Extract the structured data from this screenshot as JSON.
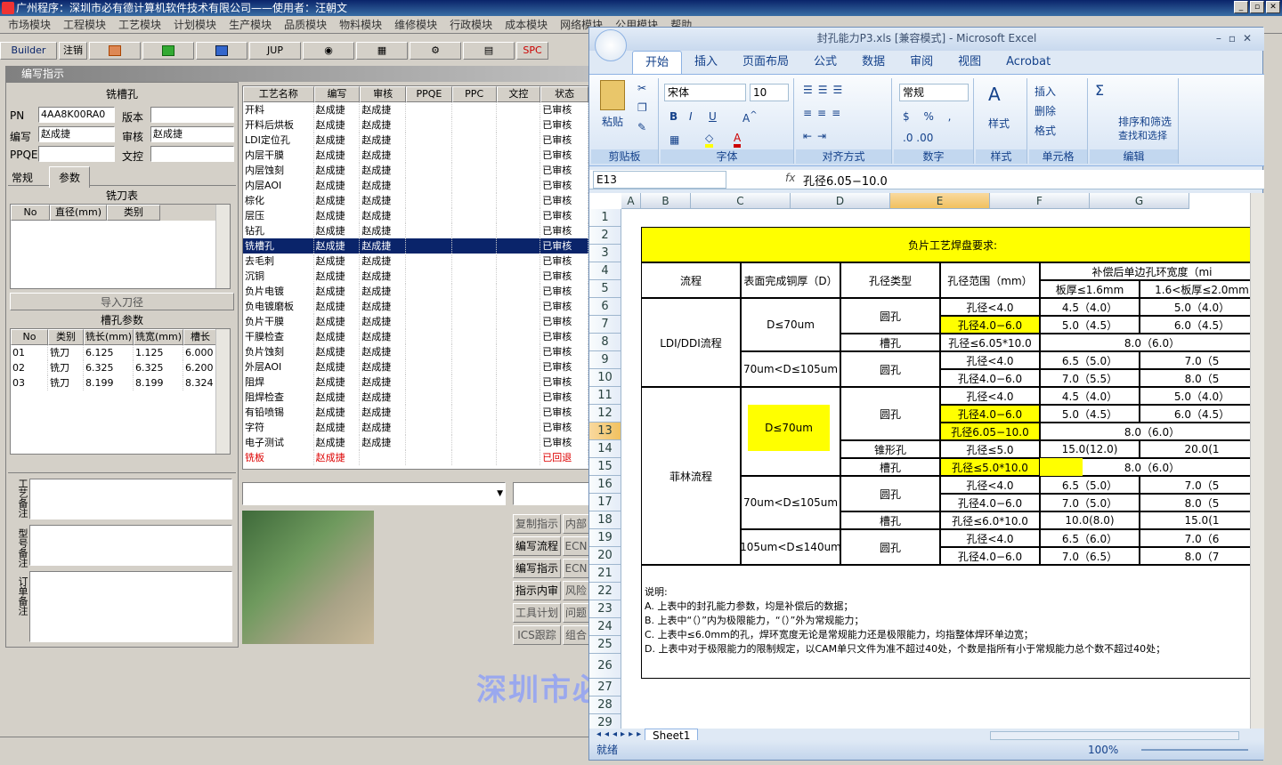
{
  "app": {
    "title": "广州程序：深圳市必有德计算机软件技术有限公司——使用者：汪朝文"
  },
  "menu": [
    "市场模块",
    "工程模块",
    "工艺模块",
    "计划模块",
    "生产模块",
    "品质模块",
    "物料模块",
    "维修模块",
    "行政模块",
    "成本模块",
    "网络模块",
    "公用模块",
    "帮助"
  ],
  "toolbar": {
    "builder": "Builder",
    "logout": "注销",
    "jup": "JUP",
    "spc": "SPC"
  },
  "panel": {
    "title": "编写指示",
    "section": "铣槽孔",
    "pn_label": "PN",
    "pn_value": "4AA8K00RA0",
    "version_label": "版本",
    "version_value": "",
    "writer_label": "编写",
    "writer_value": "赵成捷",
    "reviewer_label": "审核",
    "reviewer_value": "赵成捷",
    "ppqe_label": "PPQE",
    "ppqe_value": "",
    "doc_label": "文控",
    "doc_value": "",
    "tab_general": "常规",
    "tab_params": "参数",
    "knife_table": "铣刀表",
    "knife_cols": [
      "No",
      "直径(mm)",
      "类别"
    ],
    "import_btn": "导入刀径",
    "slot_params": "槽孔参数",
    "slot_cols": [
      "No",
      "类别",
      "铣长(mm)",
      "铣宽(mm)",
      "槽长(mm"
    ],
    "slot_rows": [
      [
        "01",
        "铣刀",
        "6.125",
        "1.125",
        "6.000"
      ],
      [
        "02",
        "铣刀",
        "6.325",
        "6.325",
        "6.200"
      ],
      [
        "03",
        "铣刀",
        "8.199",
        "8.199",
        "8.324"
      ]
    ],
    "note1": "工艺备注",
    "note2": "型号备注",
    "note3": "订单备注"
  },
  "process": {
    "cols": [
      "工艺名称",
      "编写",
      "审核",
      "PPQE",
      "PPC",
      "文控",
      "状态"
    ],
    "rows": [
      [
        "开料",
        "赵成捷",
        "赵成捷",
        "",
        "",
        "",
        "已审核"
      ],
      [
        "开料后烘板",
        "赵成捷",
        "赵成捷",
        "",
        "",
        "",
        "已审核"
      ],
      [
        "LDI定位孔",
        "赵成捷",
        "赵成捷",
        "",
        "",
        "",
        "已审核"
      ],
      [
        "内层干膜",
        "赵成捷",
        "赵成捷",
        "",
        "",
        "",
        "已审核"
      ],
      [
        "内层蚀刻",
        "赵成捷",
        "赵成捷",
        "",
        "",
        "",
        "已审核"
      ],
      [
        "内层AOI",
        "赵成捷",
        "赵成捷",
        "",
        "",
        "",
        "已审核"
      ],
      [
        "棕化",
        "赵成捷",
        "赵成捷",
        "",
        "",
        "",
        "已审核"
      ],
      [
        "层压",
        "赵成捷",
        "赵成捷",
        "",
        "",
        "",
        "已审核"
      ],
      [
        "钻孔",
        "赵成捷",
        "赵成捷",
        "",
        "",
        "",
        "已审核"
      ],
      [
        "铣槽孔",
        "赵成捷",
        "赵成捷",
        "",
        "",
        "",
        "已审核"
      ],
      [
        "去毛刺",
        "赵成捷",
        "赵成捷",
        "",
        "",
        "",
        "已审核"
      ],
      [
        "沉铜",
        "赵成捷",
        "赵成捷",
        "",
        "",
        "",
        "已审核"
      ],
      [
        "负片电镀",
        "赵成捷",
        "赵成捷",
        "",
        "",
        "",
        "已审核"
      ],
      [
        "负电镀磨板",
        "赵成捷",
        "赵成捷",
        "",
        "",
        "",
        "已审核"
      ],
      [
        "负片干膜",
        "赵成捷",
        "赵成捷",
        "",
        "",
        "",
        "已审核"
      ],
      [
        "干膜检查",
        "赵成捷",
        "赵成捷",
        "",
        "",
        "",
        "已审核"
      ],
      [
        "负片蚀刻",
        "赵成捷",
        "赵成捷",
        "",
        "",
        "",
        "已审核"
      ],
      [
        "外层AOI",
        "赵成捷",
        "赵成捷",
        "",
        "",
        "",
        "已审核"
      ],
      [
        "阻焊",
        "赵成捷",
        "赵成捷",
        "",
        "",
        "",
        "已审核"
      ],
      [
        "阻焊检查",
        "赵成捷",
        "赵成捷",
        "",
        "",
        "",
        "已审核"
      ],
      [
        "有铅喷锡",
        "赵成捷",
        "赵成捷",
        "",
        "",
        "",
        "已审核"
      ],
      [
        "字符",
        "赵成捷",
        "赵成捷",
        "",
        "",
        "",
        "已审核"
      ],
      [
        "电子测试",
        "赵成捷",
        "赵成捷",
        "",
        "",
        "",
        "已审核"
      ],
      [
        "铣板",
        "赵成捷",
        "",
        "",
        "",
        "",
        "已回退"
      ]
    ],
    "buttons": [
      "复制指示",
      "编写流程",
      "编写指示",
      "指示内审",
      "工具计划",
      "ICS跟踪"
    ],
    "buttons2": [
      "内部",
      "ECN",
      "ECN",
      "风险",
      "问题",
      "组合"
    ]
  },
  "watermark": "深圳市必",
  "excel": {
    "title": "封孔能力P3.xls [兼容模式] - Microsoft Excel",
    "tabs": [
      "开始",
      "插入",
      "页面布局",
      "公式",
      "数据",
      "审阅",
      "视图",
      "Acrobat"
    ],
    "groups": [
      "剪贴板",
      "字体",
      "对齐方式",
      "数字",
      "样式",
      "单元格",
      "编辑"
    ],
    "paste": "粘贴",
    "font": "宋体",
    "size": "10",
    "numfmt": "常规",
    "style": "样式",
    "insert": "插入",
    "delete": "删除",
    "format": "格式",
    "sort": "排序和筛选",
    "find": "查找和选择",
    "namebox": "E13",
    "formula": "孔径6.05−10.0",
    "cols": [
      "A",
      "B",
      "C",
      "D",
      "E",
      "F",
      "G"
    ],
    "rows": [
      "1",
      "2",
      "3",
      "4",
      "5",
      "6",
      "7",
      "8",
      "9",
      "10",
      "11",
      "12",
      "13",
      "14",
      "15",
      "16",
      "17",
      "18",
      "19",
      "20",
      "21",
      "22",
      "23",
      "24",
      "25",
      "26",
      "27",
      "28",
      "29"
    ],
    "heading": "负片工艺焊盘要求:",
    "h_flow": "流程",
    "h_cu": "表面完成铜厚（D）",
    "h_type": "孔径类型",
    "h_range": "孔径范围（mm）",
    "h_ring": "补偿后单边孔环宽度（mi",
    "h_t1": "板厚≤1.6mm",
    "h_t2": "1.6<板厚≤2.0mm",
    "flow1": "LDI/DDI流程",
    "flow2": "菲林流程",
    "d1": "D≤70um",
    "d2": "70um<D≤105um",
    "d3": "D≤70um",
    "d4": "70um<D≤105um",
    "d5": "105um<D≤140um",
    "t_round": "圆孔",
    "t_slot": "槽孔",
    "t_cone": "锥形孔",
    "r": [
      "孔径<4.0",
      "孔径4.0−6.0",
      "孔径≤6.05*10.0",
      "孔径<4.0",
      "孔径4.0−6.0",
      "孔径<4.0",
      "孔径4.0−6.0",
      "孔径6.05−10.0",
      "孔径≤5.0",
      "孔径≤5.0*10.0",
      "孔径<4.0",
      "孔径4.0−6.0",
      "孔径≤6.0*10.0",
      "孔径<4.0",
      "孔径4.0−6.0"
    ],
    "f": [
      "4.5（4.0）",
      "5.0（4.5）",
      "",
      "6.5（5.0）",
      "7.0（5.5）",
      "4.5（4.0）",
      "5.0（4.5）",
      "",
      "15.0(12.0)",
      "",
      "6.5（5.0）",
      "7.0（5.0）",
      "10.0(8.0)",
      "6.5（6.0）",
      "7.0（6.5）"
    ],
    "g": [
      "5.0（4.0）",
      "6.0（4.5）",
      "",
      "7.0（5",
      "8.0（5",
      "5.0（4.0）",
      "6.0（4.5）",
      "",
      "20.0(1",
      "",
      "7.0（5",
      "8.0（5",
      "15.0(1",
      "7.0（6",
      "8.0（7"
    ],
    "merged": [
      "8.0（6.0）",
      "8.0（6.0）",
      "8.0（6.0）"
    ],
    "notes": [
      "说明:",
      "A. 上表中的封孔能力参数，均是补偿后的数据；",
      "B. 上表中“（）”内为极限能力，“（）”外为常规能力；",
      "C. 上表中≤6.0mm的孔，焊环宽度无论是常规能力还是极限能力，均指整体焊环单边宽；",
      "D. 上表中对于极限能力的限制规定，以CAM单只文件为准不超过40处，个数是指所有小于常规能力总个数不超过40处；"
    ],
    "sheet_tab": "Sheet1",
    "status": "就绪",
    "zoom": "100%"
  }
}
